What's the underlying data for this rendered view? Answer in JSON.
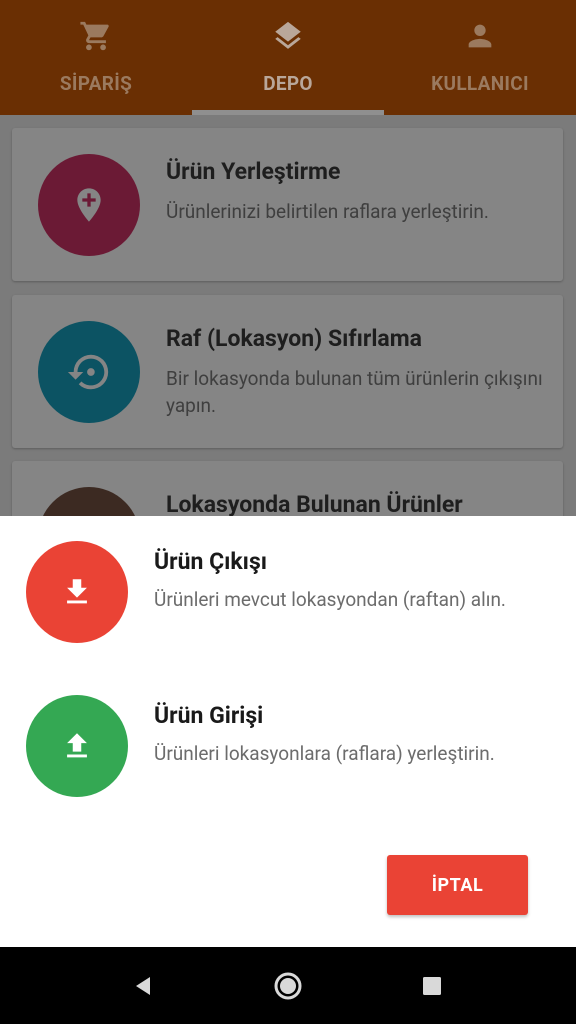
{
  "tabs": [
    {
      "label": "SİPARİŞ",
      "icon": "cart-icon"
    },
    {
      "label": "DEPO",
      "icon": "layers-icon",
      "active": true
    },
    {
      "label": "KULLANICI",
      "icon": "person-icon"
    }
  ],
  "cards": [
    {
      "title": "Ürün Yerleştirme",
      "desc": "Ürünlerinizi belirtilen raflara yerleştirin.",
      "icon": "location-add-icon",
      "color": "#6b1a35"
    },
    {
      "title": "Raf (Lokasyon) Sıfırlama",
      "desc": "Bir lokasyonda bulunan tüm ürünlerin çıkışını yapın.",
      "icon": "restore-icon",
      "color": "#0c5363"
    },
    {
      "title": "Lokasyonda Bulunan Ürünler",
      "desc": "",
      "icon": "list-icon",
      "color": "#3c2a22"
    }
  ],
  "sheet": {
    "options": [
      {
        "title": "Ürün Çıkışı",
        "desc": "Ürünleri mevcut lokasyondan (raftan) alın.",
        "icon": "download-icon",
        "color": "#ea4335"
      },
      {
        "title": "Ürün Girişi",
        "desc": "Ürünleri lokasyonlara (raflara) yerleştirin.",
        "icon": "upload-icon",
        "color": "#34a853"
      }
    ],
    "cancel_label": "İPTAL"
  },
  "navbar": {
    "back": "back-icon",
    "home": "home-icon",
    "recents": "recents-icon"
  }
}
